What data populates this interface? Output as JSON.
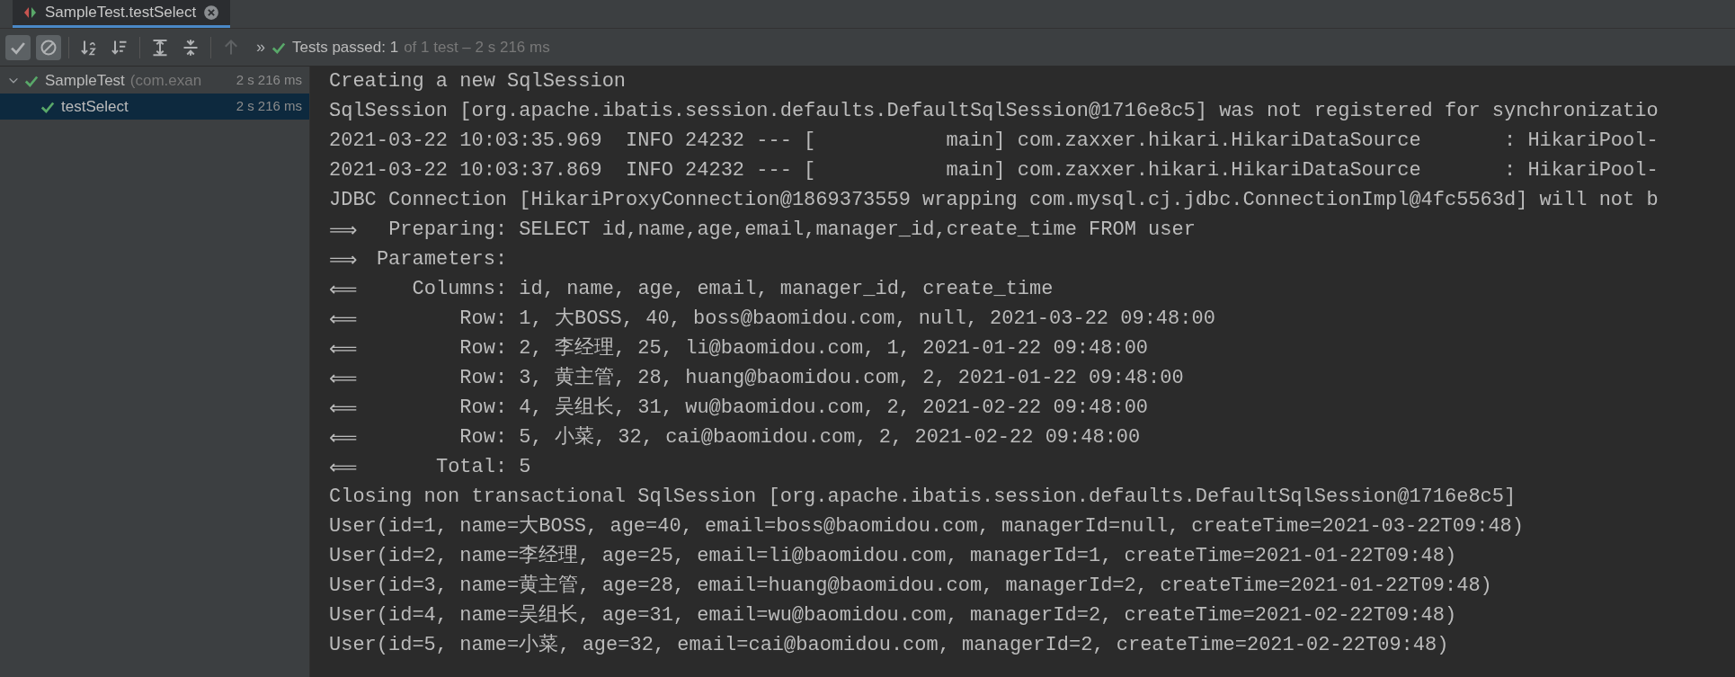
{
  "tab": {
    "title": "SampleTest.testSelect",
    "selected": true
  },
  "toolbar": {
    "buttons": [
      {
        "kind": "show-passed",
        "pressed": true,
        "disabled": false
      },
      {
        "kind": "show-ignored",
        "pressed": true,
        "disabled": false
      },
      {
        "kind": "sort-alpha",
        "pressed": false,
        "disabled": false
      },
      {
        "kind": "sort-duration",
        "pressed": false,
        "disabled": false
      },
      {
        "kind": "expand-all",
        "pressed": false,
        "disabled": false
      },
      {
        "kind": "collapse-all",
        "pressed": false,
        "disabled": false
      },
      {
        "kind": "previous",
        "pressed": false,
        "disabled": true
      }
    ],
    "more": "»",
    "status": {
      "passed": "Tests passed: 1",
      "detail": "of 1 test – 2 s 216 ms"
    }
  },
  "tree": [
    {
      "name": "SampleTest",
      "detail": "(com.exan",
      "time": "2 s 216 ms",
      "passed": true,
      "expanded": true,
      "selected": false,
      "children": [
        {
          "name": "testSelect",
          "time": "2 s 216 ms",
          "passed": true,
          "selected": true
        }
      ]
    }
  ],
  "console": [
    {
      "kind": "plain",
      "text": "Creating a new SqlSession"
    },
    {
      "kind": "plain",
      "text": "SqlSession [org.apache.ibatis.session.defaults.DefaultSqlSession@1716e8c5] was not registered for synchronizatio"
    },
    {
      "kind": "plain",
      "text": "2021-03-22 10:03:35.969  INFO 24232 --- [           main] com.zaxxer.hikari.HikariDataSource       : HikariPool-"
    },
    {
      "kind": "plain",
      "text": "2021-03-22 10:03:37.869  INFO 24232 --- [           main] com.zaxxer.hikari.HikariDataSource       : HikariPool-"
    },
    {
      "kind": "plain",
      "text": "JDBC Connection [HikariProxyConnection@1869373559 wrapping com.mysql.cj.jdbc.ConnectionImpl@4fc5563d] will not b"
    },
    {
      "kind": "sql",
      "arrow": "⟹",
      "label": "Preparing:",
      "text": "SELECT id,name,age,email,manager_id,create_time FROM user"
    },
    {
      "kind": "sql",
      "arrow": "⟹",
      "label": "Parameters:"
    },
    {
      "kind": "sql",
      "arrow": "⟸",
      "label": "Columns:",
      "text": "id, name, age, email, manager_id, create_time"
    },
    {
      "kind": "sql",
      "arrow": "⟸",
      "label": "Row:",
      "text": "1, 大BOSS, 40, boss@baomidou.com, null, 2021-03-22 09:48:00"
    },
    {
      "kind": "sql",
      "arrow": "⟸",
      "label": "Row:",
      "text": "2, 李经理, 25, li@baomidou.com, 1, 2021-01-22 09:48:00"
    },
    {
      "kind": "sql",
      "arrow": "⟸",
      "label": "Row:",
      "text": "3, 黄主管, 28, huang@baomidou.com, 2, 2021-01-22 09:48:00"
    },
    {
      "kind": "sql",
      "arrow": "⟸",
      "label": "Row:",
      "text": "4, 吴组长, 31, wu@baomidou.com, 2, 2021-02-22 09:48:00"
    },
    {
      "kind": "sql",
      "arrow": "⟸",
      "label": "Row:",
      "text": "5, 小菜, 32, cai@baomidou.com, 2, 2021-02-22 09:48:00"
    },
    {
      "kind": "sql",
      "arrow": "⟸",
      "label": "Total:",
      "text": "5"
    },
    {
      "kind": "plain",
      "text": "Closing non transactional SqlSession [org.apache.ibatis.session.defaults.DefaultSqlSession@1716e8c5]"
    },
    {
      "kind": "plain",
      "text": "User(id=1, name=大BOSS, age=40, email=boss@baomidou.com, managerId=null, createTime=2021-03-22T09:48)"
    },
    {
      "kind": "plain",
      "text": "User(id=2, name=李经理, age=25, email=li@baomidou.com, managerId=1, createTime=2021-01-22T09:48)"
    },
    {
      "kind": "plain",
      "text": "User(id=3, name=黄主管, age=28, email=huang@baomidou.com, managerId=2, createTime=2021-01-22T09:48)"
    },
    {
      "kind": "plain",
      "text": "User(id=4, name=吴组长, age=31, email=wu@baomidou.com, managerId=2, createTime=2021-02-22T09:48)"
    },
    {
      "kind": "plain",
      "text": "User(id=5, name=小菜, age=32, email=cai@baomidou.com, managerId=2, createTime=2021-02-22T09:48)"
    }
  ]
}
